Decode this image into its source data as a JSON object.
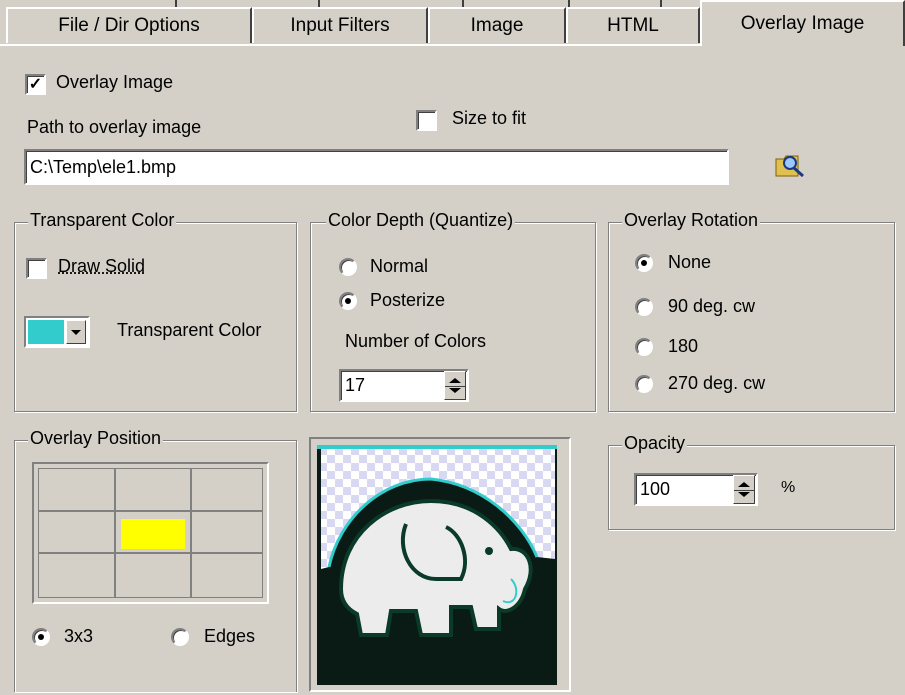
{
  "tabs": [
    {
      "label": "File / Dir Options"
    },
    {
      "label": "Input Filters"
    },
    {
      "label": "Image"
    },
    {
      "label": "HTML"
    },
    {
      "label": "Overlay Image"
    }
  ],
  "overlay": {
    "enable_label": "Overlay Image",
    "enable_checked": true,
    "path_label": "Path to overlay image",
    "path_value": "C:\\Temp\\ele1.bmp",
    "size_to_fit_label": "Size to fit",
    "size_to_fit_checked": false,
    "browse_icon": "folder-search-icon"
  },
  "transparent": {
    "title": "Transparent Color",
    "draw_solid_label": "Draw Solid",
    "draw_solid_checked": false,
    "color_label": "Transparent Color",
    "color_value": "#33cccc"
  },
  "depth": {
    "title": "Color Depth (Quantize)",
    "normal_label": "Normal",
    "posterize_label": "Posterize",
    "selected": "Posterize",
    "num_colors_label": "Number of Colors",
    "num_colors_value": "17"
  },
  "rotation": {
    "title": "Overlay Rotation",
    "options": [
      "None",
      "90 deg. cw",
      "180",
      "270 deg. cw"
    ],
    "selected": "None"
  },
  "position": {
    "title": "Overlay Position",
    "selected_cell": "center",
    "highlight_color": "#ffff00",
    "mode_3x3_label": "3x3",
    "mode_edges_label": "Edges",
    "mode_selected": "3x3"
  },
  "opacity": {
    "title": "Opacity",
    "value": "100",
    "unit": "%"
  },
  "preview": {
    "icon": "elephant-preview-image"
  }
}
